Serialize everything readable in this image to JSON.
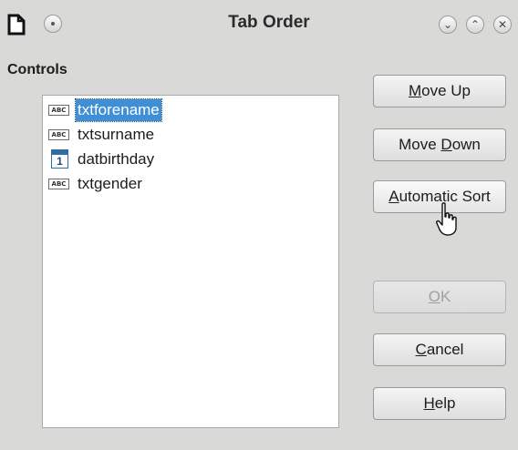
{
  "window": {
    "title": "Tab Order"
  },
  "controls_label": "Controls",
  "list": {
    "items": [
      {
        "label": "txtforename",
        "icon": "text-field-icon",
        "icon_text": "ABC",
        "selected": true
      },
      {
        "label": "txtsurname",
        "icon": "text-field-icon",
        "icon_text": "ABC",
        "selected": false
      },
      {
        "label": "datbirthday",
        "icon": "date-field-icon",
        "icon_text": "1",
        "selected": false
      },
      {
        "label": "txtgender",
        "icon": "text-field-icon",
        "icon_text": "ABC",
        "selected": false
      }
    ]
  },
  "buttons": {
    "move_up": {
      "mnemonic": "M",
      "rest": "ove Up"
    },
    "move_down": {
      "pre": "Move ",
      "mnemonic": "D",
      "rest": "own"
    },
    "automatic_sort": {
      "mnemonic": "A",
      "rest": "utomatic Sort"
    },
    "ok": {
      "mnemonic": "O",
      "rest": "K",
      "disabled": true
    },
    "cancel": {
      "mnemonic": "C",
      "rest": "ancel"
    },
    "help": {
      "mnemonic": "H",
      "rest": "elp"
    }
  }
}
